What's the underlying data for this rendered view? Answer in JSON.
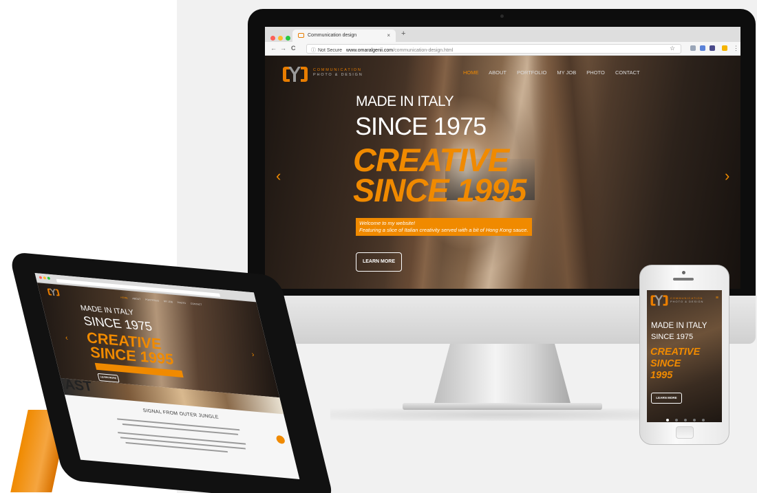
{
  "browser": {
    "tab_title": "Communication design",
    "tab_close": "×",
    "new_tab": "+",
    "security_label": "Not Secure",
    "url_host": "www.omaralgenii.com",
    "url_path": "/communication-design.html",
    "nav_back": "←",
    "nav_forward": "→",
    "nav_reload": "C",
    "info_glyph": "ⓘ",
    "menu_glyph": "⋮",
    "star_glyph": "☆",
    "traffic_light_colors": [
      "#fc5f57",
      "#fdbc2e",
      "#28c840"
    ]
  },
  "site": {
    "logo_line1": "COMMUNICATION",
    "logo_line2": "PHOTO & DESIGN",
    "menu": [
      "HOME",
      "ABOUT",
      "PORTFOLIO",
      "MY JOB",
      "PHOTO",
      "CONTACT"
    ],
    "active_menu": "HOME",
    "hero_line1": "MADE IN ITALY",
    "hero_line2": "SINCE 1975",
    "hero_line3a": "CREATIVE",
    "hero_line3b": "SINCE 1995",
    "welcome_line1": "Welcome to my website!",
    "welcome_line2": "Featuring a slice of Italian creativity served with a bit of Hong Kong sauce.",
    "cta_label": "LEARN MORE",
    "prev_arrow": "‹",
    "next_arrow": "›",
    "accent_color": "#f08a00"
  },
  "phone": {
    "hero_line3c": "1995",
    "menu_glyph": "≡",
    "slides": 5,
    "active_slide": 1
  },
  "tablet": {
    "section_title": "SIGNAL FROM OUTER JUNGLE",
    "strip_text": "AST"
  }
}
